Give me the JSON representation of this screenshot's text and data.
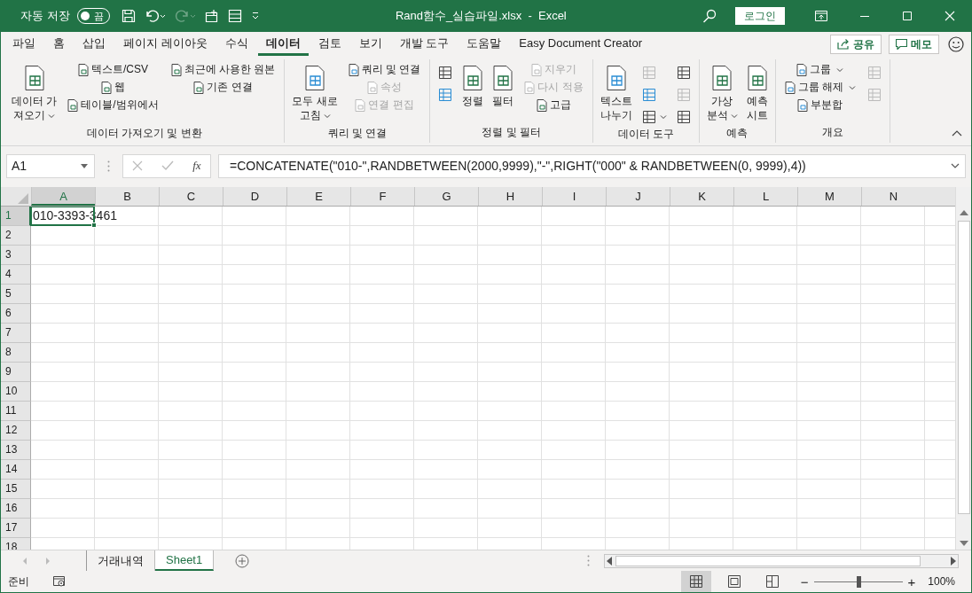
{
  "title_bar": {
    "autosave_label": "자동 저장",
    "autosave": {
      "on": false,
      "text": "끔"
    },
    "title": "Rand함수_실습파일.xlsx  -  Excel",
    "login": "로그인"
  },
  "menu_tabs": [
    {
      "label": "파일",
      "selected": false
    },
    {
      "label": "홈",
      "selected": false
    },
    {
      "label": "삽입",
      "selected": false
    },
    {
      "label": "페이지 레이아웃",
      "selected": false
    },
    {
      "label": "수식",
      "selected": false
    },
    {
      "label": "데이터",
      "selected": true
    },
    {
      "label": "검토",
      "selected": false
    },
    {
      "label": "보기",
      "selected": false
    },
    {
      "label": "개발 도구",
      "selected": false
    },
    {
      "label": "도움말",
      "selected": false
    },
    {
      "label": "Easy Document Creator",
      "selected": false
    }
  ],
  "share": "공유",
  "memo": "메모",
  "ribbon": [
    {
      "label": "데이터 가져오기 및 변환",
      "columns": [
        [
          {
            "kind": "large",
            "label": "데이터 가\n져오기",
            "dropdown": true,
            "disabled": false
          }
        ],
        [
          {
            "kind": "small",
            "label": "텍스트/CSV",
            "dropdown": false,
            "disabled": false
          },
          {
            "kind": "small",
            "label": "웹",
            "dropdown": false,
            "disabled": false
          },
          {
            "kind": "small",
            "label": "테이블/범위에서",
            "dropdown": false,
            "disabled": false
          }
        ],
        [
          {
            "kind": "small",
            "label": "최근에 사용한 원본",
            "dropdown": false,
            "disabled": false
          },
          {
            "kind": "small",
            "label": "기존 연결",
            "dropdown": false,
            "disabled": false
          }
        ]
      ]
    },
    {
      "label": "쿼리 및 연결",
      "columns": [
        [
          {
            "kind": "large",
            "label": "모두 새로\n고침",
            "dropdown": true,
            "disabled": false
          }
        ],
        [
          {
            "kind": "small",
            "label": "쿼리 및 연결",
            "dropdown": false,
            "disabled": false
          },
          {
            "kind": "small",
            "label": "속성",
            "dropdown": false,
            "disabled": true
          },
          {
            "kind": "small",
            "label": "연결 편집",
            "dropdown": false,
            "disabled": true
          }
        ]
      ]
    },
    {
      "label": "정렬 및 필터",
      "columns": [
        [
          {
            "kind": "icon",
            "dropdown": false,
            "disabled": false
          },
          {
            "kind": "icon",
            "dropdown": false,
            "disabled": false
          }
        ],
        [
          {
            "kind": "large",
            "label": "정렬",
            "dropdown": false,
            "disabled": false
          }
        ],
        [
          {
            "kind": "large",
            "label": "필터",
            "dropdown": false,
            "disabled": false
          }
        ],
        [
          {
            "kind": "small",
            "label": "지우기",
            "dropdown": false,
            "disabled": true
          },
          {
            "kind": "small",
            "label": "다시 적용",
            "dropdown": false,
            "disabled": true
          },
          {
            "kind": "small",
            "label": "고급",
            "dropdown": false,
            "disabled": false
          }
        ]
      ]
    },
    {
      "label": "데이터 도구",
      "columns": [
        [
          {
            "kind": "large",
            "label": "텍스트\n나누기",
            "dropdown": false,
            "disabled": false
          }
        ],
        [
          {
            "kind": "icon",
            "dropdown": false,
            "disabled": true
          },
          {
            "kind": "icon",
            "dropdown": false,
            "disabled": false
          },
          {
            "kind": "icon",
            "dropdown": true,
            "disabled": false
          }
        ],
        [
          {
            "kind": "icon",
            "dropdown": false,
            "disabled": false
          },
          {
            "kind": "icon",
            "dropdown": false,
            "disabled": true
          },
          {
            "kind": "icon",
            "dropdown": false,
            "disabled": false
          }
        ]
      ]
    },
    {
      "label": "예측",
      "columns": [
        [
          {
            "kind": "large",
            "label": "가상\n분석",
            "dropdown": true,
            "disabled": false
          }
        ],
        [
          {
            "kind": "large",
            "label": "예측\n시트",
            "dropdown": false,
            "disabled": false
          }
        ]
      ]
    },
    {
      "label": "개요",
      "columns": [
        [
          {
            "kind": "small",
            "label": "그룹",
            "dropdown": true,
            "disabled": false
          },
          {
            "kind": "small",
            "label": "그룹 해제",
            "dropdown": true,
            "disabled": false
          },
          {
            "kind": "small",
            "label": "부분합",
            "dropdown": false,
            "disabled": false
          }
        ],
        [
          {
            "kind": "icon",
            "dropdown": false,
            "disabled": true
          },
          {
            "kind": "icon",
            "dropdown": false,
            "disabled": true
          }
        ]
      ]
    }
  ],
  "name_box": "A1",
  "fx": "fx",
  "formula": "=CONCATENATE(\"010-\",RANDBETWEEN(2000,9999),\"-\",RIGHT(\"000\" & RANDBETWEEN(0, 9999),4))",
  "grid": {
    "columns": [
      {
        "label": "A",
        "selected": true
      },
      {
        "label": "B",
        "selected": false
      },
      {
        "label": "C",
        "selected": false
      },
      {
        "label": "D",
        "selected": false
      },
      {
        "label": "E",
        "selected": false
      },
      {
        "label": "F",
        "selected": false
      },
      {
        "label": "G",
        "selected": false
      },
      {
        "label": "H",
        "selected": false
      },
      {
        "label": "I",
        "selected": false
      },
      {
        "label": "J",
        "selected": false
      },
      {
        "label": "K",
        "selected": false
      },
      {
        "label": "L",
        "selected": false
      },
      {
        "label": "M",
        "selected": false
      },
      {
        "label": "N",
        "selected": false
      }
    ],
    "rows": [
      {
        "label": "1",
        "selected": true,
        "cells": [
          "010-3393-3461"
        ]
      },
      {
        "label": "2",
        "selected": false
      },
      {
        "label": "3",
        "selected": false
      },
      {
        "label": "4",
        "selected": false
      },
      {
        "label": "5",
        "selected": false
      },
      {
        "label": "6",
        "selected": false
      },
      {
        "label": "7",
        "selected": false
      },
      {
        "label": "8",
        "selected": false
      },
      {
        "label": "9",
        "selected": false
      },
      {
        "label": "10",
        "selected": false
      },
      {
        "label": "11",
        "selected": false
      },
      {
        "label": "12",
        "selected": false
      },
      {
        "label": "13",
        "selected": false
      },
      {
        "label": "14",
        "selected": false
      },
      {
        "label": "15",
        "selected": false
      },
      {
        "label": "16",
        "selected": false
      },
      {
        "label": "17",
        "selected": false
      },
      {
        "label": "18",
        "selected": false
      }
    ]
  },
  "sheet_tabs": [
    {
      "label": "거래내역",
      "selected": false
    },
    {
      "label": "Sheet1",
      "selected": true
    }
  ],
  "status": "준비",
  "views": [
    {
      "kind": "normal",
      "selected": true
    },
    {
      "kind": "page-layout",
      "selected": false
    },
    {
      "kind": "page-break",
      "selected": false
    }
  ],
  "zoom": {
    "level": 0.5,
    "text": "100%",
    "minus": "−",
    "plus": "+"
  }
}
